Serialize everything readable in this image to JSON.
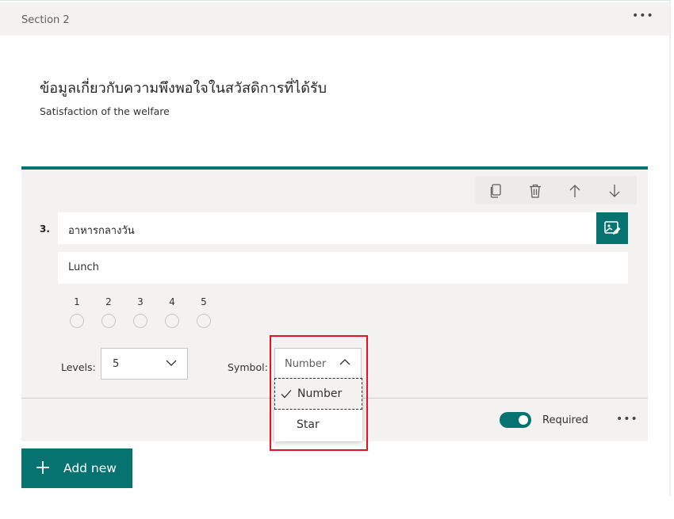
{
  "section": {
    "label": "Section 2",
    "more": "•••",
    "title": "ข้อมูลเกี่ยวกับความพึงพอใจในสวัสดิการที่ได้รับ",
    "subtitle": "Satisfaction of the welfare"
  },
  "question": {
    "number": "3.",
    "title": "อาหารกลางวัน",
    "subtitle": "Lunch",
    "toolbar": [
      "copy-icon",
      "delete-icon",
      "move-up-icon",
      "move-down-icon"
    ],
    "rating_numbers": [
      "1",
      "2",
      "3",
      "4",
      "5"
    ],
    "levels_label": "Levels:",
    "levels_value": "5",
    "symbol_label": "Symbol:",
    "symbol_value": "Number",
    "required_label": "Required",
    "required_on": true,
    "more": "•••"
  },
  "symbol_dropdown": {
    "options": [
      "Number",
      "Star"
    ],
    "selected": "Number"
  },
  "add_new": {
    "label": "Add new"
  },
  "colors": {
    "accent": "#077371",
    "highlight": "#e81123",
    "surface": "#f3f2f1"
  }
}
